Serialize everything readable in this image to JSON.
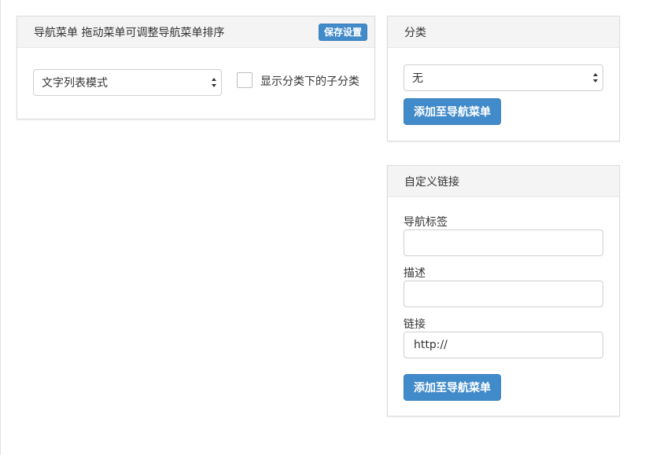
{
  "nav_menu": {
    "title": "导航菜单 拖动菜单可调整导航菜单排序",
    "save_button": "保存设置",
    "display_mode_selected": "文字列表模式",
    "show_subcategories_label": "显示分类下的子分类",
    "show_subcategories_checked": false
  },
  "category": {
    "title": "分类",
    "selected": "无",
    "add_button": "添加至导航菜单"
  },
  "custom_link": {
    "title": "自定义链接",
    "nav_label": "导航标签",
    "nav_label_value": "",
    "description_label": "描述",
    "description_value": "",
    "link_label": "链接",
    "link_value": "http://",
    "add_button": "添加至导航菜单"
  },
  "colors": {
    "primary": "#428bca",
    "header_bg": "#f4f4f4"
  }
}
